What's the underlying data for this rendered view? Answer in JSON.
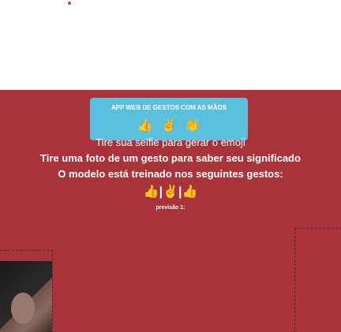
{
  "header": {
    "app_title": "APP WEB DE GESTOS COM AS MÃOS",
    "gesture_emojis": "👍 ✌ 👏"
  },
  "instructions": {
    "line1": "Tire sua selfie para gerar o emoji",
    "line2": "Tire uma foto de um gesto para saber seu significado",
    "line3": "O modelo está treinado nos seguintes gestos:",
    "gestures": "👍|✌|👍",
    "prediction_label": "previsão 1:"
  },
  "colors": {
    "banner": "#a8333a",
    "card": "#5bc0de"
  }
}
